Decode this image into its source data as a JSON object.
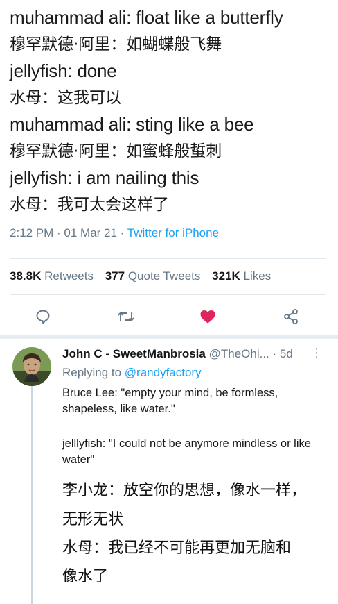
{
  "tweet": {
    "lines": [
      "muhammad ali: float like a butterfly",
      "穆罕默德·阿里：如蝴蝶般飞舞",
      "jellyfish: done",
      "水母：这我可以",
      "muhammad ali: sting like a bee",
      "穆罕默德·阿里：如蜜蜂般蜇刺",
      "jellyfish: i am nailing this",
      "水母：我可太会这样了"
    ],
    "time": "2:12 PM · 01 Mar 21 · ",
    "source": "Twitter for iPhone",
    "retweets_count": "38.8K",
    "retweets_label": "Retweets",
    "quotes_count": "377",
    "quotes_label": "Quote Tweets",
    "likes_count": "321K",
    "likes_label": "Likes",
    "like_color": "#e0245e"
  },
  "actions": {
    "reply_icon": "comment-icon",
    "retweet_icon": "retweet-icon",
    "like_icon": "heart-icon",
    "share_icon": "share-icon"
  },
  "reply": {
    "name": "John C - SweetManbrosia",
    "handle": "@TheOhi...",
    "age": "· 5d",
    "replying_prefix": "Replying to ",
    "replying_to": "@randyfactory",
    "para1": "Bruce Lee: \"empty your mind, be formless, shapeless, like water.\"",
    "para2": "jelllyfish: \"I could not  be anymore mindless or like water\"",
    "zh_lines": [
      "李小龙：放空你的思想，像水一样，",
      "无形无状",
      "水母：我已经不可能再更加无脑和",
      "像水了"
    ]
  }
}
